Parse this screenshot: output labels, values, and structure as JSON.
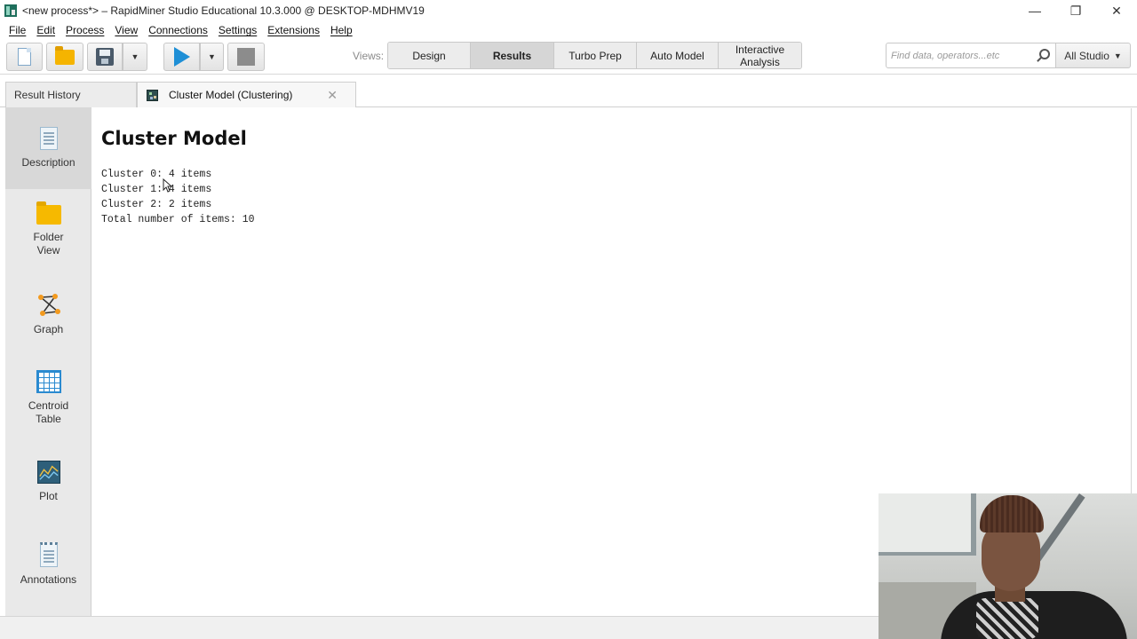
{
  "window": {
    "title": "<new process*> – RapidMiner Studio Educational 10.3.000 @ DESKTOP-MDHMV19",
    "minimize_glyph": "—",
    "restore_glyph": "❐",
    "close_glyph": "✕"
  },
  "menu": [
    "File",
    "Edit",
    "Process",
    "View",
    "Connections",
    "Settings",
    "Extensions",
    "Help"
  ],
  "toolbar": {
    "views_label": "Views:",
    "view_tabs": [
      {
        "label": "Design",
        "active": false
      },
      {
        "label": "Results",
        "active": true
      },
      {
        "label": "Turbo Prep",
        "active": false
      },
      {
        "label": "Auto Model",
        "active": false
      },
      {
        "label": "Interactive Analysis",
        "active": false
      }
    ],
    "search_placeholder": "Find data, operators...etc",
    "studio_select": "All Studio",
    "dropdown_glyph": "▼"
  },
  "doc_tabs": {
    "history": "Result History",
    "active": "Cluster Model (Clustering)",
    "close_glyph": "✕"
  },
  "side_panel": [
    {
      "label": "Description",
      "icon": "description-icon",
      "selected": true
    },
    {
      "label": "Folder View",
      "icon": "folder-icon",
      "selected": false
    },
    {
      "label": "Graph",
      "icon": "graph-icon",
      "selected": false
    },
    {
      "label": "Centroid Table",
      "icon": "table-icon",
      "selected": false
    },
    {
      "label": "Plot",
      "icon": "plot-icon",
      "selected": false
    },
    {
      "label": "Annotations",
      "icon": "annotations-icon",
      "selected": false
    }
  ],
  "result": {
    "title": "Cluster Model",
    "lines": [
      "Cluster 0: 4 items",
      "Cluster 1: 4 items",
      "Cluster 2: 2 items",
      "Total number of items: 10"
    ]
  },
  "colors": {
    "accent": "#1e8fd6",
    "selected_side": "#d8d8d8",
    "active_view_tab": "#d6d6d6"
  }
}
